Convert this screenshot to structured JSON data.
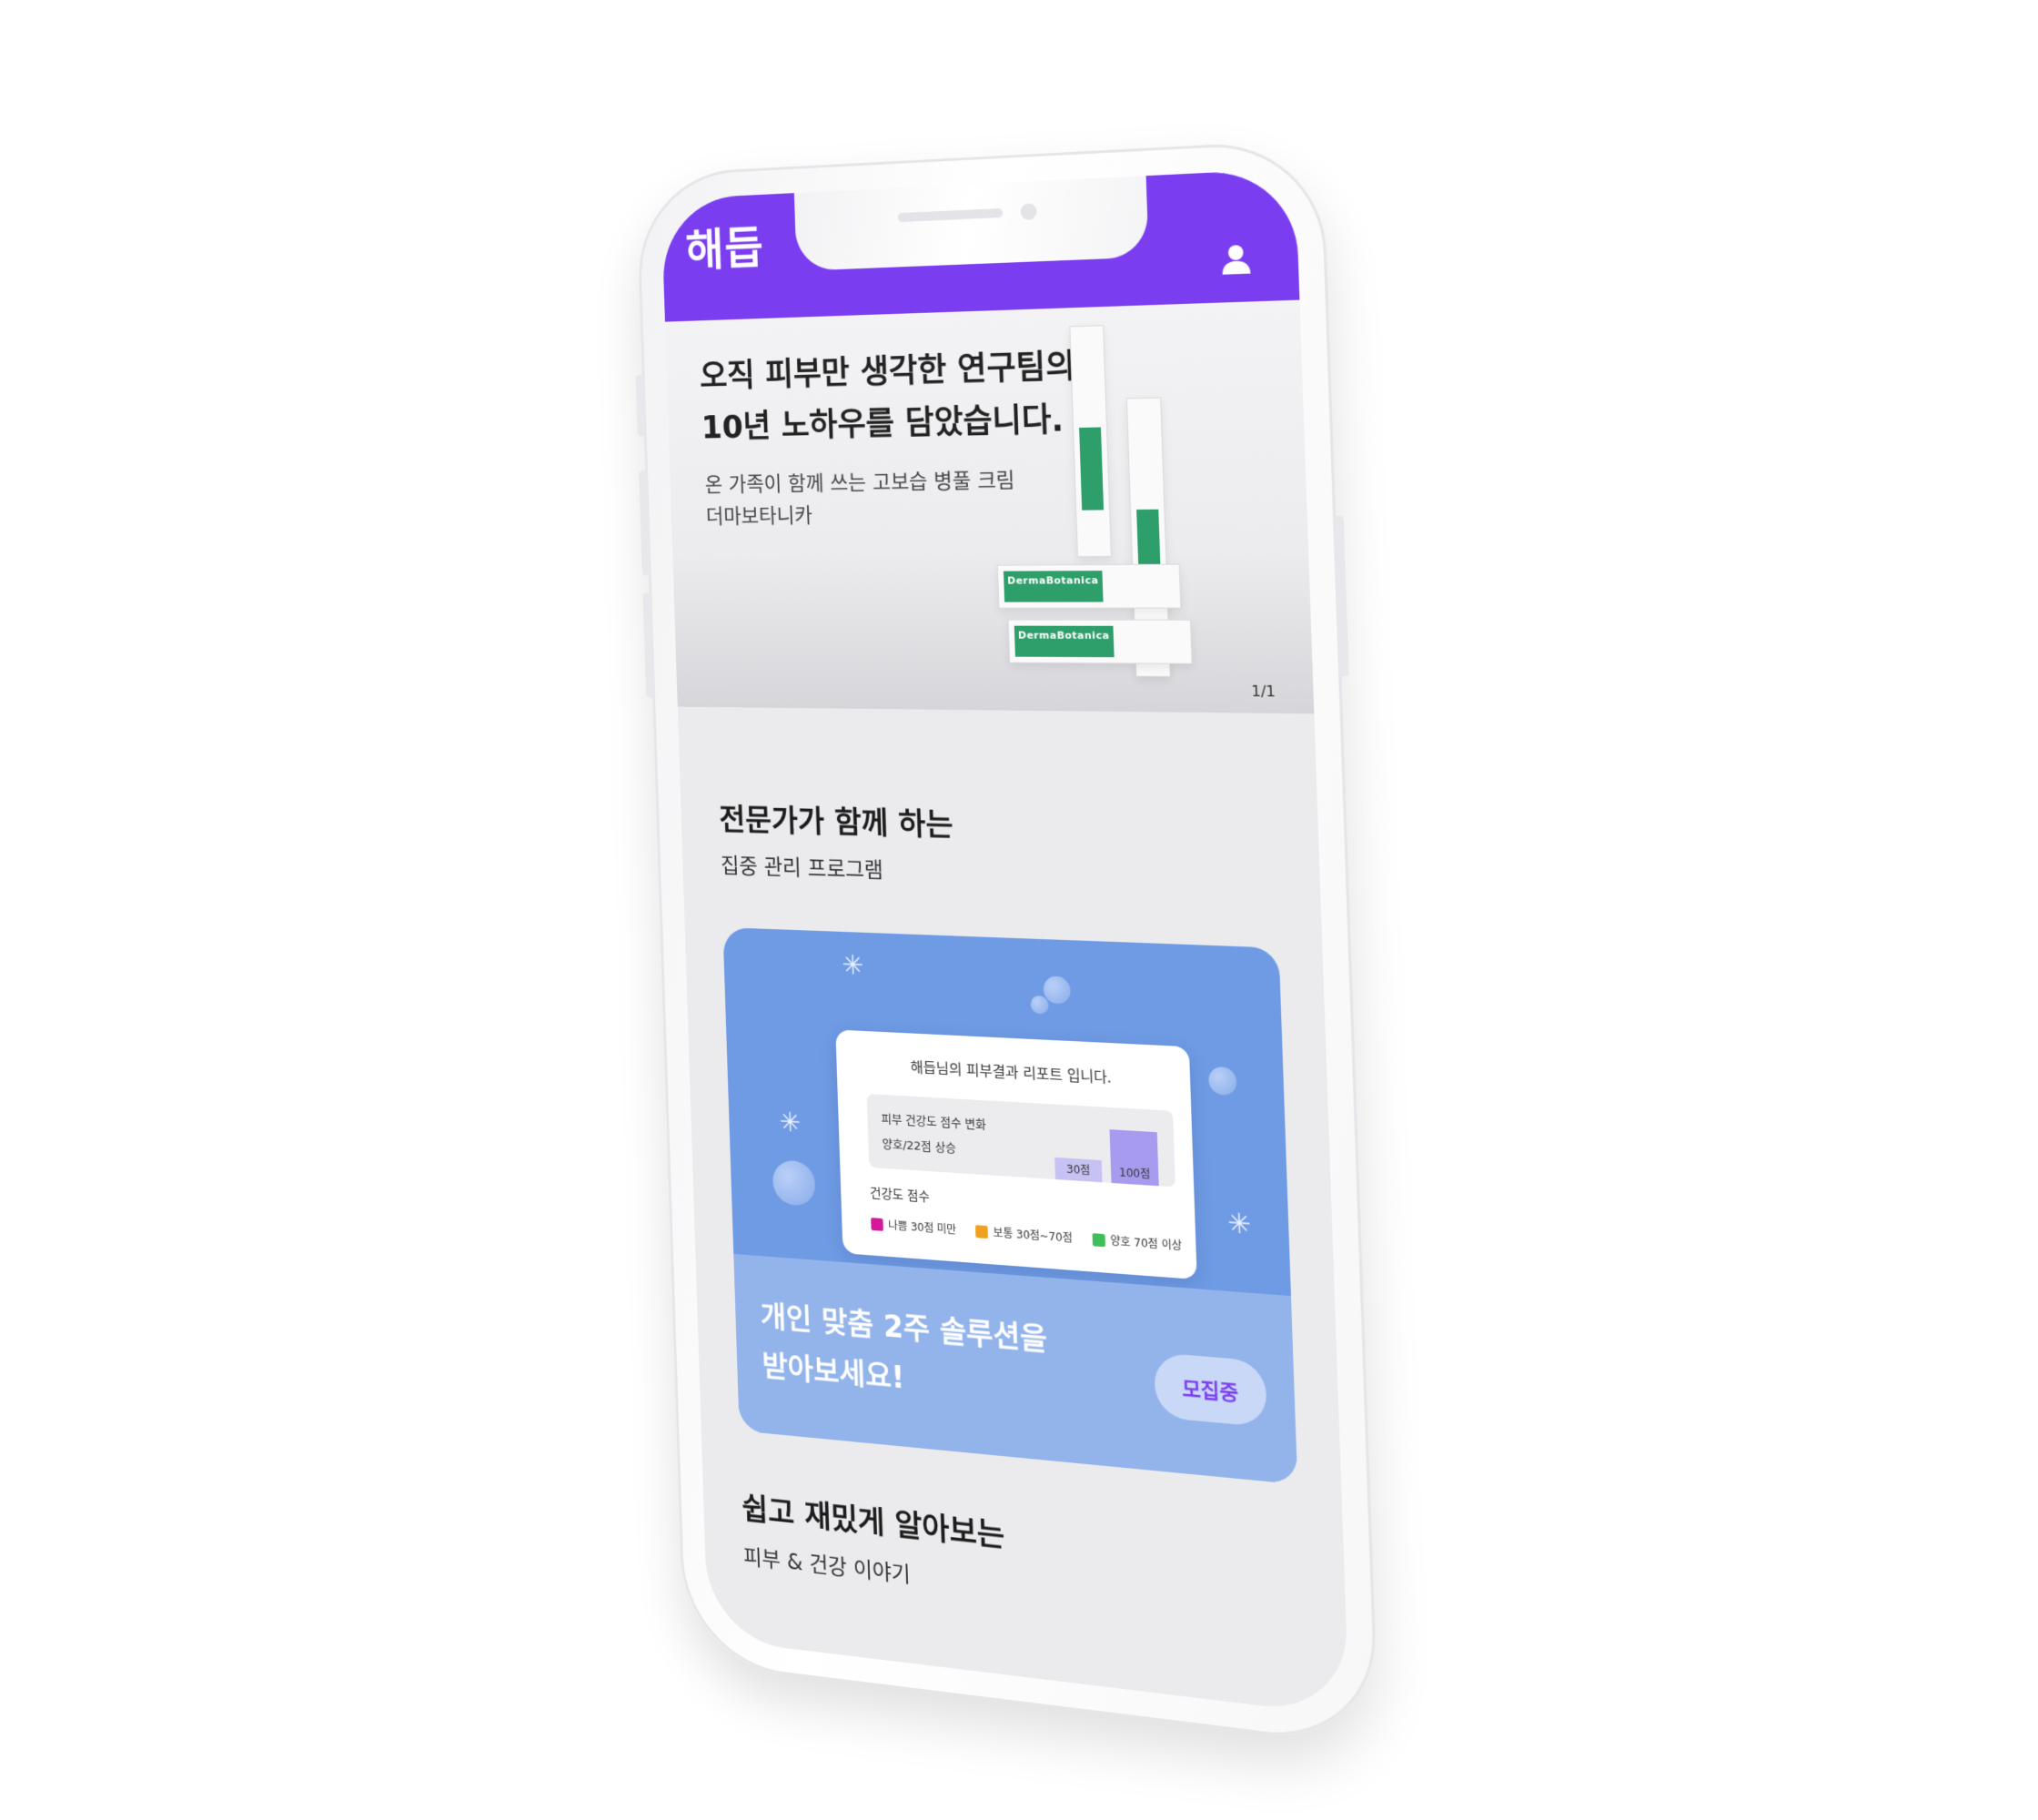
{
  "header": {
    "logo": "해듭",
    "user_icon": "user-icon"
  },
  "hero": {
    "title_line1": "오직 피부만 생각한 연구팀의",
    "title_line2": "10년 노하우를 담았습니다.",
    "sub_line1": "온 가족이 함께 쓰는 고보습 병풀 크림",
    "sub_line2": "더마보타니카",
    "product_brand": "DermaBotanica",
    "pager": "1/1"
  },
  "program_section": {
    "title": "전문가가 함께 하는",
    "subtitle": "집중 관리 프로그램",
    "report": {
      "title": "해듭님의 피부결과 리포트 입니다.",
      "score_label": "피부 건강도 점수 변화",
      "score_delta": "양호/22점 상승",
      "bar_before": "30점",
      "bar_after": "100점",
      "legend_title": "건강도 점수",
      "legend": [
        {
          "label": "나쁨 30점 미만",
          "color": "#d21a9a"
        },
        {
          "label": "보통 30점~70점",
          "color": "#f2a11f"
        },
        {
          "label": "양호 70점 이상",
          "color": "#3fbf5a"
        }
      ]
    },
    "cta_line1": "개인 맞춤 2주 솔루션을",
    "cta_line2": "받아보세요!",
    "cta_button": "모집중"
  },
  "story_section": {
    "title": "쉽고 재밌게 알아보는",
    "subtitle": "피부 & 건강 이야기"
  },
  "colors": {
    "brand": "#7a3df0",
    "card": "#6f9be4",
    "cta": "#93b4ea"
  }
}
